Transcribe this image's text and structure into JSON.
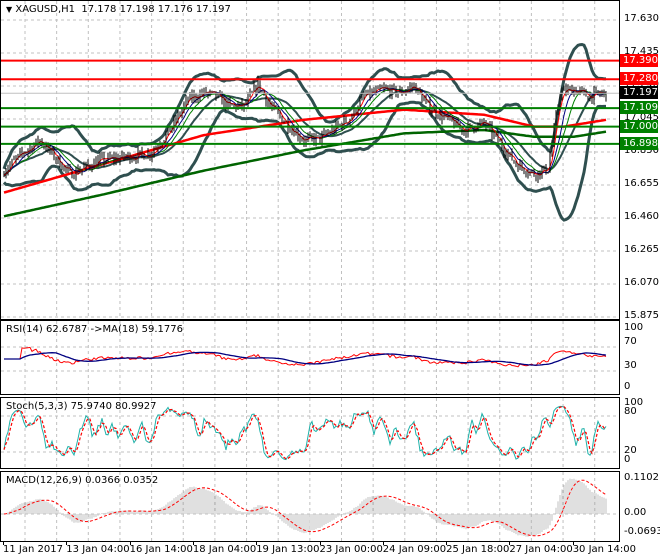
{
  "header": {
    "symbol": "XAGUSD,H1",
    "ohlc": "17.178 17.198 17.176 17.197"
  },
  "colors": {
    "resistance": "#ff0000",
    "support": "#008000",
    "bollinger": "#2f4f4f",
    "ma_fast": "#ff0000",
    "ma_mid": "#000080",
    "ma_slow": "#008000",
    "bars": "#000000",
    "rsi": "#ff0000",
    "rsi_ma": "#000080",
    "stoch_main": "#20b2aa",
    "stoch_signal": "#ff0000",
    "macd_hist": "#c0c0c0",
    "macd_signal": "#ff0000"
  },
  "price_axis": [
    "17.630",
    "17.435",
    "17.240",
    "17.045",
    "16.850",
    "16.655",
    "16.460",
    "16.265",
    "16.070",
    "15.875"
  ],
  "levels": [
    {
      "value": "17.390",
      "type": "resistance"
    },
    {
      "value": "17.280",
      "type": "resistance"
    },
    {
      "value": "17.109",
      "type": "support"
    },
    {
      "value": "17.000",
      "type": "support"
    },
    {
      "value": "16.898",
      "type": "support"
    }
  ],
  "current_price": "17.197",
  "rsi": {
    "label": "RSI(14) 62.6787  ->MA(18) 59.1776",
    "axis": [
      "100",
      "70",
      "30",
      "0"
    ]
  },
  "stoch": {
    "label": "Stoch(5,3,3) 75.9740 80.9927",
    "axis": [
      "100",
      "80",
      "20",
      "0"
    ]
  },
  "macd": {
    "label": "MACD(12,26,9) 0.0366 0.0352",
    "axis": [
      "0.1102",
      "0.00",
      "-0.0693"
    ]
  },
  "time_axis": [
    "11 Jan 2017",
    "13 Jan 04:00",
    "16 Jan 14:00",
    "18 Jan 04:00",
    "19 Jan 13:00",
    "23 Jan 00:00",
    "24 Jan 09:00",
    "25 Jan 18:00",
    "27 Jan 04:00",
    "30 Jan 14:00"
  ],
  "chart_data": {
    "type": "candlestick",
    "bars": 302,
    "price_path": [
      [
        0,
        16.74
      ],
      [
        10,
        16.85
      ],
      [
        18,
        16.92
      ],
      [
        33,
        16.72
      ],
      [
        48,
        16.8
      ],
      [
        73,
        16.84
      ],
      [
        83,
        16.98
      ],
      [
        92,
        17.16
      ],
      [
        100,
        17.2
      ],
      [
        106,
        17.18
      ],
      [
        113,
        17.12
      ],
      [
        120,
        17.12
      ],
      [
        127,
        17.25
      ],
      [
        133,
        17.12
      ],
      [
        143,
        17.0
      ],
      [
        150,
        16.92
      ],
      [
        158,
        16.93
      ],
      [
        167,
        17.0
      ],
      [
        173,
        17.05
      ],
      [
        180,
        17.18
      ],
      [
        190,
        17.22
      ],
      [
        198,
        17.2
      ],
      [
        205,
        17.24
      ],
      [
        212,
        17.12
      ],
      [
        222,
        17.04
      ],
      [
        230,
        16.98
      ],
      [
        240,
        17.02
      ],
      [
        248,
        16.9
      ],
      [
        256,
        16.78
      ],
      [
        265,
        16.72
      ],
      [
        272,
        16.75
      ],
      [
        278,
        17.2
      ],
      [
        285,
        17.22
      ],
      [
        292,
        17.18
      ],
      [
        301,
        17.197
      ]
    ],
    "ma100": [
      [
        0,
        16.61
      ],
      [
        50,
        16.78
      ],
      [
        100,
        16.95
      ],
      [
        150,
        17.04
      ],
      [
        200,
        17.1
      ],
      [
        240,
        17.07
      ],
      [
        265,
        17.0
      ],
      [
        280,
        17.0
      ],
      [
        301,
        17.04
      ]
    ],
    "ma200": [
      [
        0,
        16.47
      ],
      [
        50,
        16.6
      ],
      [
        100,
        16.74
      ],
      [
        150,
        16.86
      ],
      [
        200,
        16.96
      ],
      [
        240,
        16.98
      ],
      [
        265,
        16.94
      ],
      [
        285,
        16.94
      ],
      [
        301,
        16.97
      ]
    ],
    "ylim": [
      15.875,
      17.7
    ]
  }
}
